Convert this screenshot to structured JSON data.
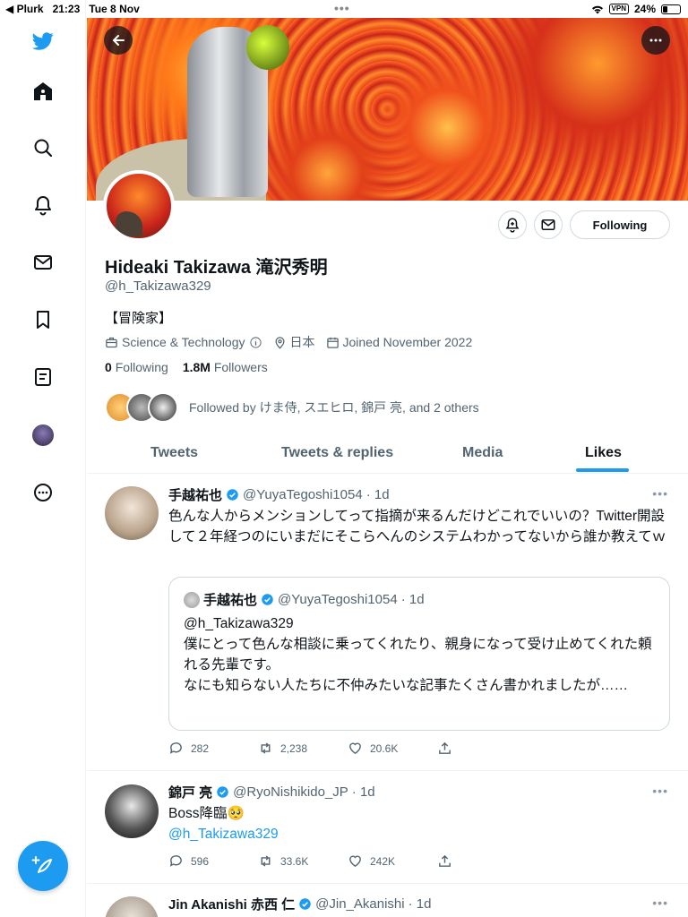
{
  "status_bar": {
    "carrier": "◀ Plurk",
    "time": "21:23",
    "date": "Tue 8 Nov",
    "dots": "•••",
    "vpn": "VPN",
    "battery": "24%"
  },
  "sidebar": {
    "items": [
      "twitter-logo",
      "home",
      "explore",
      "notifications",
      "messages",
      "bookmarks",
      "lists",
      "profile",
      "more"
    ]
  },
  "header": {
    "back_icon": "arrow-left-icon",
    "more_icon": "more-icon"
  },
  "profile": {
    "name": "Hideaki Takizawa 滝沢秀明",
    "handle": "@h_Takizawa329",
    "bio": "【冒険家】",
    "category": "Science & Technology",
    "location": "日本",
    "joined": "Joined November 2022",
    "following_count": "0",
    "following_label": "Following",
    "followers_count": "1.8M",
    "followers_label": "Followers",
    "followed_by": "Followed by けま侍, スエヒロ, 錦戸 亮, and 2 others",
    "follow_button": "Following"
  },
  "tabs": [
    {
      "label": "Tweets"
    },
    {
      "label": "Tweets & replies"
    },
    {
      "label": "Media"
    },
    {
      "label": "Likes",
      "active": true
    }
  ],
  "tweets": [
    {
      "name": "手越祐也",
      "handle": "@YuyaTegoshi1054",
      "time": "· 1d",
      "text": "色んな人からメンションしてって指摘が来るんだけどこれでいいの？Twitter開設して２年経つのにいまだにそこらへんのシステムわかってないから誰か教えてｗ",
      "quote": {
        "name": "手越祐也",
        "handle": "@YuyaTegoshi1054",
        "time": "· 1d",
        "text": "@h_Takizawa329\n僕にとって色んな相談に乗ってくれたり、親身になって受け止めてくれた頼れる先輩です。\nなにも知らない人たちに不仲みたいな記事たくさん書かれましたが……"
      },
      "replies": "282",
      "retweets": "2,238",
      "likes": "20.6K"
    },
    {
      "name": "錦戸 亮",
      "handle": "@RyoNishikido_JP",
      "time": "· 1d",
      "text": "Boss降臨🥺",
      "link": "@h_Takizawa329",
      "replies": "596",
      "retweets": "33.6K",
      "likes": "242K"
    },
    {
      "name": "Jin Akanishi  赤西 仁",
      "handle": "@Jin_Akanishi",
      "time": "· 1d"
    }
  ],
  "colors": {
    "accent": "#1d9bf0",
    "text": "#0f1419",
    "secondary": "#536471",
    "border": "#eff3f4"
  }
}
